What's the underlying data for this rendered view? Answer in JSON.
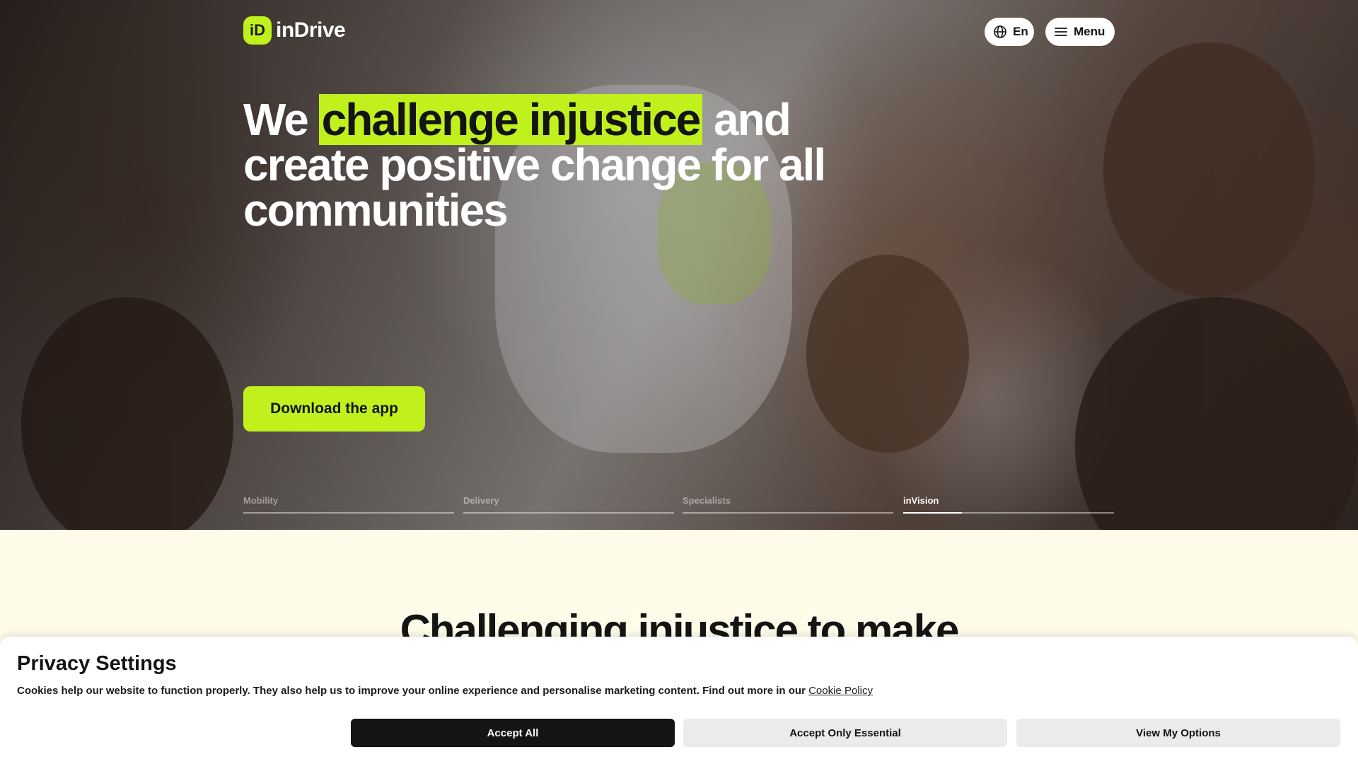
{
  "header": {
    "logo_mark": "iD",
    "logo_text": "inDrive",
    "lang_label": "En",
    "menu_label": "Menu"
  },
  "hero": {
    "headline_before": "We ",
    "headline_highlight": "challenge injustice",
    "headline_after": " and create positive change for all communities",
    "cta_label": "Download the app"
  },
  "tabs": [
    {
      "label": "Mobility",
      "progress": 0
    },
    {
      "label": "Delivery",
      "progress": 0
    },
    {
      "label": "Specialists",
      "progress": 0
    },
    {
      "label": "inVision",
      "progress": 0.28
    }
  ],
  "section": {
    "title": "Challenging injustice to make"
  },
  "cookie": {
    "title": "Privacy Settings",
    "text": "Cookies help our website to function properly. They also help us to improve your online experience and personalise marketing content. Find out more in our ",
    "link_label": "Cookie Policy",
    "accept_all": "Accept All",
    "accept_essential": "Accept Only Essential",
    "view_options": "View My Options"
  },
  "colors": {
    "accent": "#c1f11d",
    "dark": "#141414",
    "section_bg": "#fefbe8"
  }
}
